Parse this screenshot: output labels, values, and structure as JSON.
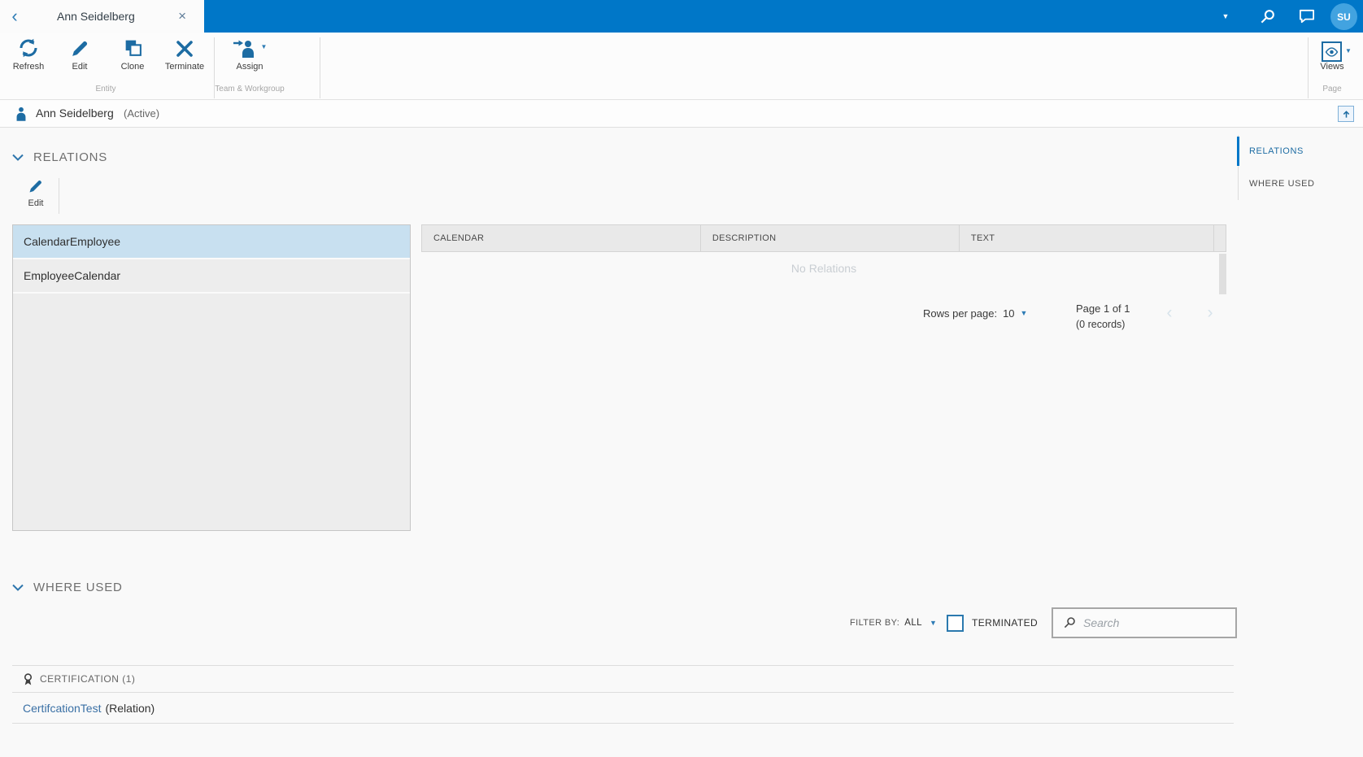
{
  "topbar": {
    "tab_title": "Ann Seidelberg",
    "avatar_initials": "SU"
  },
  "icons": {
    "back": "‹",
    "close": "×",
    "caret_down": "▼",
    "chevron_left": "‹",
    "chevron_right": "›"
  },
  "toolbar": {
    "refresh": "Refresh",
    "edit": "Edit",
    "clone": "Clone",
    "terminate": "Terminate",
    "assign": "Assign",
    "group_entity": "Entity",
    "group_team_workgroup": "Team & Workgroup",
    "views": "Views",
    "group_page": "Page"
  },
  "entity_header": {
    "name": "Ann Seidelberg",
    "status": "(Active)"
  },
  "side_nav": {
    "items": [
      {
        "label": "RELATIONS",
        "active": true
      },
      {
        "label": "WHERE USED",
        "active": false
      }
    ]
  },
  "relations": {
    "title": "RELATIONS",
    "edit_label": "Edit",
    "list": [
      "CalendarEmployee",
      "EmployeeCalendar"
    ],
    "selected_item": "CalendarEmployee",
    "columns": [
      "CALENDAR",
      "DESCRIPTION",
      "TEXT"
    ],
    "empty_text": "No Relations",
    "rows_per_page_label": "Rows per page:",
    "rows_per_page_value": "10",
    "page_text": "Page 1 of 1",
    "records_text": "(0 records)"
  },
  "where_used": {
    "title": "WHERE USED",
    "filter_by_label": "FILTER BY:",
    "filter_by_value": "ALL",
    "terminated_label": "TERMINATED",
    "search_placeholder": "Search",
    "certification_title": "CERTIFICATION (1)",
    "items": [
      {
        "link": "CertifcationTest",
        "suffix": "(Relation)"
      }
    ]
  },
  "colors": {
    "brand_blue": "#0077c8",
    "icon_blue": "#1d6ca3",
    "selected_row": "#c8e0f0",
    "link": "#3a70a5",
    "avatar_bg": "#42a3e0"
  }
}
